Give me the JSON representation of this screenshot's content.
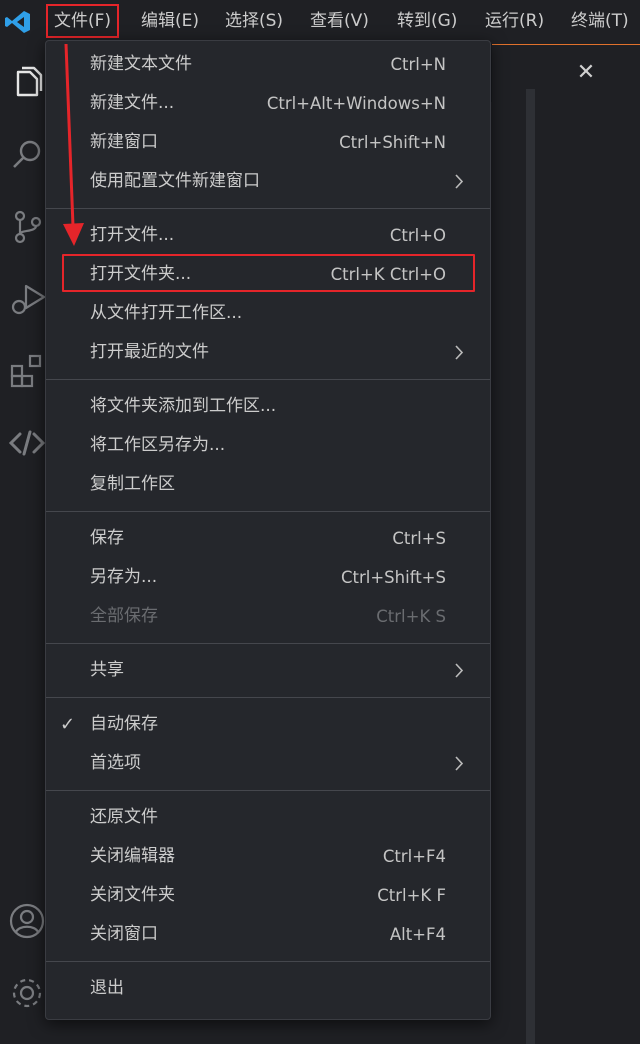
{
  "menubar": {
    "items": [
      {
        "label": "文件(F)"
      },
      {
        "label": "编辑(E)"
      },
      {
        "label": "选择(S)"
      },
      {
        "label": "查看(V)"
      },
      {
        "label": "转到(G)"
      },
      {
        "label": "运行(R)"
      },
      {
        "label": "终端(T)"
      }
    ]
  },
  "editor": {
    "tab_close": "✕"
  },
  "file_menu": {
    "groups": [
      [
        {
          "label": "新建文本文件",
          "shortcut": "Ctrl+N"
        },
        {
          "label": "新建文件...",
          "shortcut": "Ctrl+Alt+Windows+N"
        },
        {
          "label": "新建窗口",
          "shortcut": "Ctrl+Shift+N"
        },
        {
          "label": "使用配置文件新建窗口",
          "submenu": true
        }
      ],
      [
        {
          "label": "打开文件...",
          "shortcut": "Ctrl+O"
        },
        {
          "label": "打开文件夹...",
          "shortcut": "Ctrl+K Ctrl+O",
          "highlighted": true
        },
        {
          "label": "从文件打开工作区..."
        },
        {
          "label": "打开最近的文件",
          "submenu": true
        }
      ],
      [
        {
          "label": "将文件夹添加到工作区..."
        },
        {
          "label": "将工作区另存为..."
        },
        {
          "label": "复制工作区"
        }
      ],
      [
        {
          "label": "保存",
          "shortcut": "Ctrl+S"
        },
        {
          "label": "另存为...",
          "shortcut": "Ctrl+Shift+S"
        },
        {
          "label": "全部保存",
          "shortcut": "Ctrl+K S",
          "disabled": true
        }
      ],
      [
        {
          "label": "共享",
          "submenu": true
        }
      ],
      [
        {
          "label": "自动保存",
          "checked": true
        },
        {
          "label": "首选项",
          "submenu": true
        }
      ],
      [
        {
          "label": "还原文件"
        },
        {
          "label": "关闭编辑器",
          "shortcut": "Ctrl+F4"
        },
        {
          "label": "关闭文件夹",
          "shortcut": "Ctrl+K F"
        },
        {
          "label": "关闭窗口",
          "shortcut": "Alt+F4"
        }
      ],
      [
        {
          "label": "退出"
        }
      ]
    ],
    "check_glyph": "✓"
  },
  "colors": {
    "accent_red": "#e5252a",
    "vscode_blue": "#2f9fe8",
    "tab_top": "#e0712c"
  },
  "icons": [
    "vscode-logo-icon",
    "explorer-icon",
    "search-icon",
    "source-control-icon",
    "run-debug-icon",
    "extensions-icon",
    "remote-icon",
    "account-icon",
    "settings-gear-icon",
    "chevron-right-icon",
    "close-icon",
    "checkmark-icon"
  ]
}
